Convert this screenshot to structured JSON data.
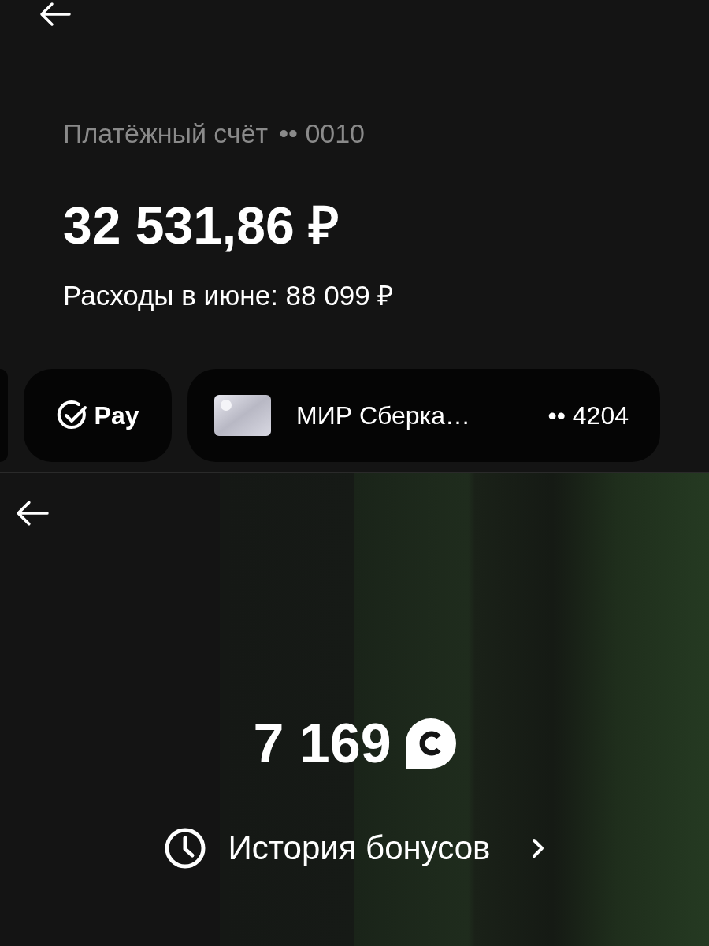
{
  "account_screen": {
    "account_label": "Платёжный счёт",
    "account_mask": "•• 0010",
    "balance": "32 531,86 ₽",
    "expenses": "Расходы в июне: 88 099 ₽",
    "chips": [
      {
        "kind": "partial"
      },
      {
        "kind": "pay",
        "label": "Pay"
      },
      {
        "kind": "card",
        "label": "МИР Сберка…",
        "mask": "•• 4204"
      }
    ]
  },
  "bonus_screen": {
    "amount": "7 169",
    "link": "История бонусов"
  }
}
